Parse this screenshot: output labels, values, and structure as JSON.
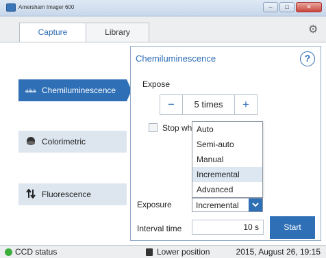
{
  "window": {
    "title": "Amersham Imager 600",
    "minimize_glyph": "–",
    "maximize_glyph": "□",
    "close_glyph": "✕"
  },
  "tabs": [
    {
      "label": "Capture",
      "active": true
    },
    {
      "label": "Library",
      "active": false
    }
  ],
  "settings_icon": "gear-icon",
  "sidebar": {
    "items": [
      {
        "label": "Chemiluminescence",
        "icon": "chemiluminescence-icon",
        "active": true
      },
      {
        "label": "Colorimetric",
        "icon": "colorimetric-icon",
        "active": false
      },
      {
        "label": "Fluorescence",
        "icon": "fluorescence-arrows-icon",
        "active": false
      }
    ]
  },
  "panel": {
    "title": "Chemiluminescence",
    "help_label": "?",
    "expose_label": "Expose",
    "expose_value": "5 times",
    "minus_label": "−",
    "plus_label": "+",
    "stop_label": "Stop wh",
    "exposure_label": "Exposure",
    "exposure_value": "Incremental",
    "exposure_options": [
      "Auto",
      "Semi-auto",
      "Manual",
      "Incremental",
      "Advanced"
    ],
    "exposure_options_highlighted": "Incremental",
    "interval_label": "Interval time",
    "interval_value": "10 s",
    "start_label": "Start"
  },
  "statusbar": {
    "ccd_label": "CCD status",
    "ccd_color": "#3cae3c",
    "position_label": "Lower position",
    "date": "2015, August 26, 19:15"
  },
  "colors": {
    "accent": "#2f6fb6",
    "title_blue": "#2e6db4"
  }
}
